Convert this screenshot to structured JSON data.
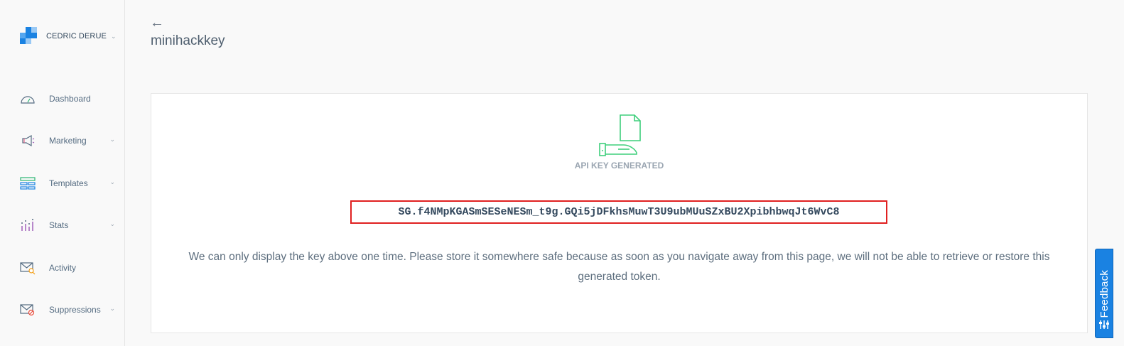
{
  "account": {
    "name": "CEDRIC DERUE"
  },
  "sidebar": {
    "items": [
      {
        "label": "Dashboard",
        "icon": "dashboard-gauge-icon",
        "has_submenu": false
      },
      {
        "label": "Marketing",
        "icon": "megaphone-icon",
        "has_submenu": true
      },
      {
        "label": "Templates",
        "icon": "templates-icon",
        "has_submenu": true
      },
      {
        "label": "Stats",
        "icon": "stats-bar-icon",
        "has_submenu": true
      },
      {
        "label": "Activity",
        "icon": "activity-envelope-icon",
        "has_submenu": false
      },
      {
        "label": "Suppressions",
        "icon": "suppressions-envelope-icon",
        "has_submenu": true
      }
    ]
  },
  "header": {
    "back_icon": "back-arrow-icon",
    "title": "minihackkey"
  },
  "main": {
    "icon": "api-key-generated-icon",
    "generated_label": "API KEY GENERATED",
    "api_key": "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",
    "notice": "We can only display the key above one time. Please store it somewhere safe because as soon as you navigate away from this page, we will not be able to retrieve or restore this generated token."
  },
  "feedback": {
    "label": "Feedback"
  },
  "colors": {
    "accent": "#1a82e2",
    "success_icon": "#3fcf7c",
    "highlight_border": "#e02020",
    "text_dark": "#34495e"
  }
}
